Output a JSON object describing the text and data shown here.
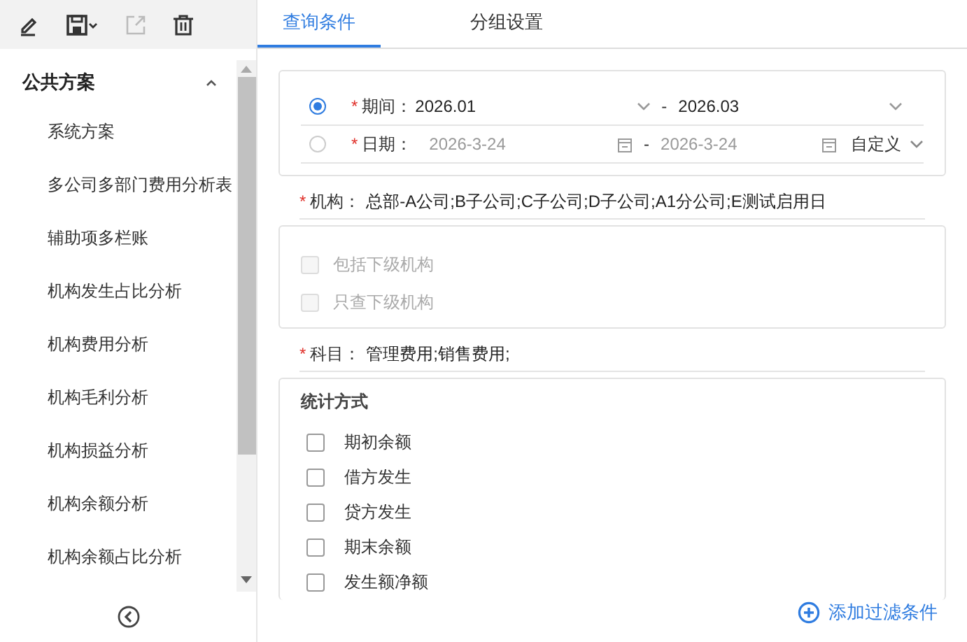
{
  "toolbar": [
    {
      "kind": "edit",
      "disabled": false
    },
    {
      "kind": "save",
      "disabled": false
    },
    {
      "kind": "export",
      "disabled": true
    },
    {
      "kind": "delete",
      "disabled": false
    }
  ],
  "sidebar": {
    "group": {
      "title": "公共方案",
      "expanded": true
    },
    "items": [
      "系统方案",
      "多公司多部门费用分析表",
      "辅助项多栏账",
      "机构发生占比分析",
      "机构费用分析",
      "机构毛利分析",
      "机构损益分析",
      "机构余额分析",
      "机构余额占比分析"
    ]
  },
  "tabs": [
    {
      "label": "查询条件",
      "selected": true
    },
    {
      "label": "分组设置",
      "selected": false
    }
  ],
  "range_rows": [
    {
      "kind": "period",
      "required": "*",
      "selected": true,
      "label": "期间：",
      "from": "2026.01",
      "dash": "-",
      "to": "2026.03"
    },
    {
      "kind": "date",
      "required": "*",
      "selected": false,
      "label": "日期：",
      "from": "2026-3-24",
      "dash": "-",
      "to": "2026-3-24",
      "preset": "自定义"
    }
  ],
  "org": {
    "required": "*",
    "label": "机构：",
    "value": "总部-A公司;B子公司;C子公司;D子公司;A1分公司;E测试启用日"
  },
  "org_options": [
    {
      "label": "包括下级机构",
      "checked": false,
      "disabled": true
    },
    {
      "label": "只查下级机构",
      "checked": false,
      "disabled": true
    }
  ],
  "subject": {
    "required": "*",
    "label": "科目：",
    "value": "管理费用;销售费用;"
  },
  "stat": {
    "title": "统计方式",
    "options": [
      {
        "label": "期初余额",
        "checked": false
      },
      {
        "label": "借方发生",
        "checked": false
      },
      {
        "label": "贷方发生",
        "checked": false
      },
      {
        "label": "期末余额",
        "checked": false
      },
      {
        "label": "发生额净额",
        "checked": false
      }
    ]
  },
  "add_filter": "添加过滤条件"
}
